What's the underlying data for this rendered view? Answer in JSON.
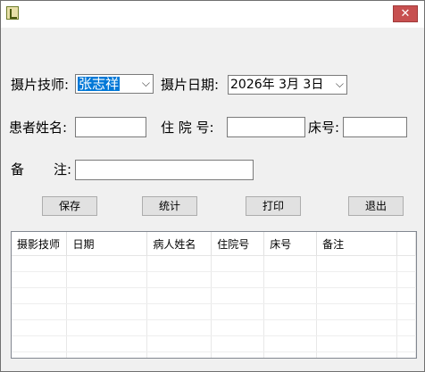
{
  "window": {
    "close_glyph": "✕"
  },
  "form": {
    "tech_label": "摄片技师:",
    "tech_value": "张志祥",
    "date_label": "摄片日期:",
    "date_value": "2026年 3月 3日",
    "patient_label": "患者姓名:",
    "patient_value": "",
    "inpatient_label": "住 院 号:",
    "inpatient_value": "",
    "bed_label": "床号:",
    "bed_value": "",
    "remark_label_1": "备",
    "remark_label_2": "注:",
    "remark_value": ""
  },
  "buttons": {
    "save": "保存",
    "stats": "统计",
    "print": "打印",
    "exit": "退出"
  },
  "table": {
    "columns": [
      "摄影技师",
      "日期",
      "病人姓名",
      "住院号",
      "床号",
      "备注"
    ],
    "rows": []
  }
}
